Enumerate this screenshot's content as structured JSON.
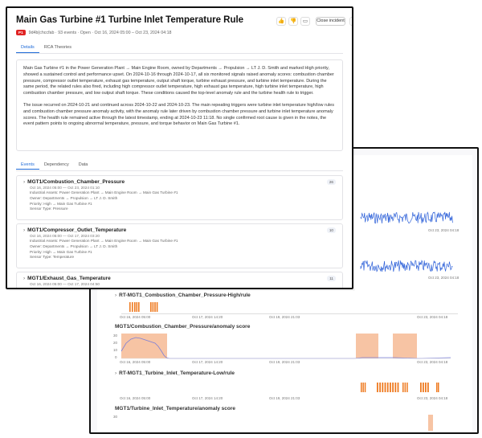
{
  "incident": {
    "title": "Main Gas Turbine #1 Turbine Inlet Temperature Rule",
    "priority_badge": "P1",
    "meta": "9d4b(chccfab · 93 events · Open · Oct 16, 2024 05:00 – Oct 23, 2024 04:18",
    "close_label": "Close incident"
  },
  "tabs": [
    {
      "label": "Details"
    },
    {
      "label": "RCA Theories"
    }
  ],
  "summary": {
    "p1": "Main Gas Turbine #1 in the Power Generation Plant → Main Engine Room, owned by Departments → Propulsion → LT J. D. Smith and marked High priority, showed a sustained control and performance upset. On 2024-10-16 through 2024-10-17, all six monitored signals raised anomaly scores: combustion chamber pressure, compressor outlet temperature, exhaust gas temperature, output shaft torque, turbine exhaust pressure, and turbine inlet temperature. During the same period, the related rules also fired, including high compressor outlet temperature, high exhaust gas temperature, high turbine inlet temperature, high combustion chamber pressure, and low output shaft torque. These conditions caused the top-level anomaly rule and the turbine health rule to trigger.",
    "p2": "The issue recurred on 2024-10-21 and continued across 2024-10-22 and 2024-10-23. The main repeating triggers were turbine inlet temperature high/low rules and combustion chamber pressure anomaly activity, with the anomaly rule later driven by combustion chamber pressure and turbine inlet temperature anomaly scores. The health rule remained active through the latest timestamp, ending at 2024-10-23 11:18. No single confirmed root cause is given in the notes, the event pattern points to ongoing abnormal temperature, pressure, and torque behavior on Main Gas Turbine #1."
  },
  "subtabs": [
    {
      "label": "Events"
    },
    {
      "label": "Dependency"
    },
    {
      "label": "Data"
    }
  ],
  "events": [
    {
      "name": "MGT1/Combustion_Chamber_Pressure",
      "dates": "Oct 16, 2024 05:00 — Oct 23, 2024 01:10",
      "assets": "Industrial Assets: Power Generation Plant → Main Engine Room → Main Gas Turbine #1",
      "owner": "Owner: Departments → Propulsion → LT J. D. Smith",
      "priority": "Priority: High → Main Gas Turbine #1",
      "sensor": "Sensor Type: Pressure",
      "count": "26"
    },
    {
      "name": "MGT1/Compressor_Outlet_Temperature",
      "dates": "Oct 16, 2024 05:00 — Oct 17, 2024 03:20",
      "assets": "Industrial Assets: Power Generation Plant → Main Engine Room → Main Gas Turbine #1",
      "owner": "Owner: Departments → Propulsion → LT J. D. Smith",
      "priority": "Priority: High → Main Gas Turbine #1",
      "sensor": "Sensor Type: Temperature",
      "count": "10"
    },
    {
      "name": "MGT1/Exhaust_Gas_Temperature",
      "dates": "Oct 16, 2024 05:00 — Oct 17, 2024 04:50",
      "count": "11"
    }
  ],
  "timeline": {
    "top_date_a": "Oct 23, 2024 04:18",
    "top_date_b": "Oct 23, 2024 04:18",
    "tracks": [
      {
        "title": "RT-MGT1_Combustion_Chamber_Pressure-High/rule"
      },
      {
        "title": "MGT1/Combustion_Chamber_Pressure/anomaly score"
      },
      {
        "title": "RT-MGT1_Turbine_Inlet_Temperature-Low/rule"
      },
      {
        "title": "MGT1/Turbine_Inlet_Temperature/anomaly score"
      }
    ],
    "x_ticks": [
      "Oct 16, 2024 05:00",
      "Oct 17, 2024 14:20",
      "Oct 19, 2024 21:03",
      "Oct 23, 2024 04:18"
    ],
    "y_ticks": [
      "30",
      "20",
      "10",
      "0"
    ],
    "colors": {
      "rule": "#ee7a20",
      "score_line": "#7b7fd8",
      "score_fill": "#f7c4a4",
      "noise": "#2f62d9"
    }
  }
}
